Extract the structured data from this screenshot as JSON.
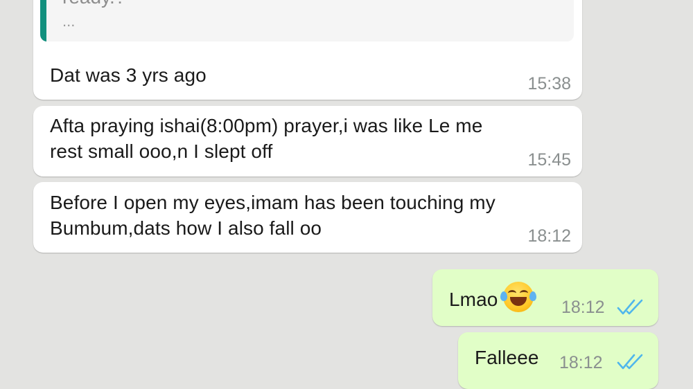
{
  "chat": {
    "quoted": {
      "text": "ready.?",
      "more": "..."
    },
    "messages": [
      {
        "direction": "incoming",
        "text": "Dat was 3 yrs ago",
        "time": "15:38"
      },
      {
        "direction": "incoming",
        "text": "Afta praying ishai(8:00pm) prayer,i was like Le me\nrest small ooo,n I slept off",
        "time": "15:45"
      },
      {
        "direction": "incoming",
        "text": "Before I open my eyes,imam has been touching my\nBumbum,dats how I also fall oo",
        "time": "18:12"
      },
      {
        "direction": "outgoing",
        "text": "Lmao",
        "emoji": "face-with-tears-of-joy",
        "time": "18:12",
        "status": "read"
      },
      {
        "direction": "outgoing",
        "text": "Falleee",
        "time": "18:12",
        "status": "read"
      }
    ]
  },
  "colors": {
    "background": "#e3e3e1",
    "incoming_bubble": "#ffffff",
    "outgoing_bubble": "#e1fec7",
    "quote_bar": "#12907e",
    "read_ticks": "#4fb6ec",
    "timestamp": "#8a8f8f"
  }
}
